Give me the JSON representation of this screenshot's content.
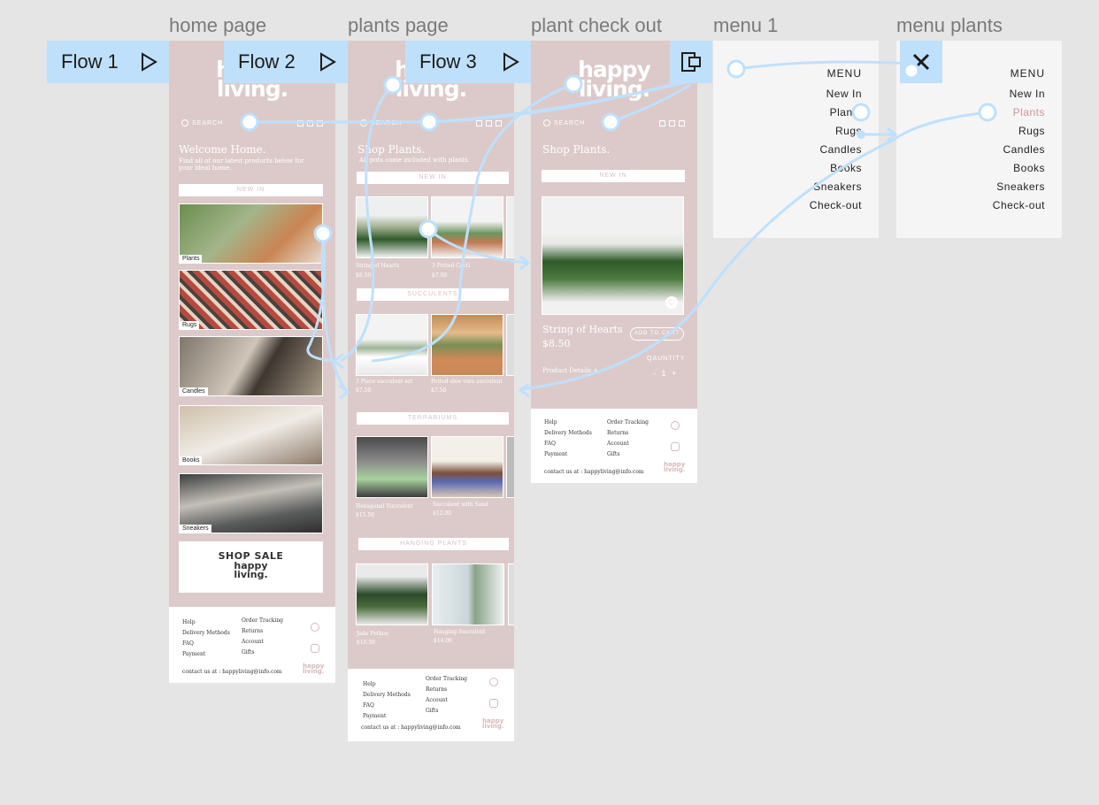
{
  "frames": {
    "home": {
      "title": "home page"
    },
    "plants": {
      "title": "plants page"
    },
    "checkout": {
      "title": "plant check out"
    },
    "menu1": {
      "title": "menu 1"
    },
    "menuplants": {
      "title": "menu plants"
    }
  },
  "flows": [
    {
      "label": "Flow 1"
    },
    {
      "label": "Flow 2"
    },
    {
      "label": "Flow 3"
    }
  ],
  "brand": {
    "logo_line1": "happy",
    "logo_line2": "living."
  },
  "search": {
    "label": "SEARCH"
  },
  "home": {
    "heading": "Welcome Home.",
    "sub1": "Find all of our latest products below for",
    "sub2": "your ideal home.",
    "new_in": "NEW IN",
    "categories": [
      "Plants",
      "Rugs",
      "Candles",
      "Books",
      "Sneakers"
    ],
    "sale": "SHOP SALE"
  },
  "plants": {
    "heading": "Shop Plants.",
    "sub": "All pots come included with plants.",
    "sections": [
      "NEW IN",
      "SUCCULENTS",
      "TERRARIUMS",
      "HANGING PLANTS"
    ],
    "row1": [
      {
        "name": "String of Hearts",
        "price": "$8.50"
      },
      {
        "name": "3 Potted Cacti",
        "price": "$7.00"
      }
    ],
    "row2": [
      {
        "name": "3 Piece succulent set",
        "price": "$7.50"
      },
      {
        "name": "Potted aloe vera succulent",
        "price": "$7.50"
      }
    ],
    "row3": [
      {
        "name": "Hexagonal Succulent",
        "price": "$15.50"
      },
      {
        "name": "Succulent with Sand",
        "price": "$12.00"
      }
    ],
    "row4": [
      {
        "name": "Jade Pothos",
        "price": "$10.50"
      },
      {
        "name": "Hanging Succulent",
        "price": "$14.00"
      }
    ]
  },
  "checkout": {
    "heading": "Shop Plants.",
    "new_in": "NEW IN",
    "product_name": "String of Hearts",
    "price": "$8.50",
    "add_to_cart": "ADD TO CART",
    "quantity_label": "QAUNTITY",
    "quantity_value": "- 1 +",
    "details": "Product Details"
  },
  "footer": {
    "col1": [
      "Help",
      "Delivery Methods",
      "FAQ",
      "Payment"
    ],
    "col2": [
      "Order Tracking",
      "Returns",
      "Account",
      "Gifts"
    ],
    "contact": "contact us at : happyliving@info.com"
  },
  "menu": {
    "title": "MENU",
    "items": [
      "New In",
      "Plants",
      "Rugs",
      "Candles",
      "Books",
      "Sneakers",
      "Check-out"
    ],
    "active_color": "#d09696"
  },
  "colors": {
    "frame_bg": "#dccaca",
    "flow_blue": "#bfe0fb",
    "connector": "#bfe0fb"
  }
}
